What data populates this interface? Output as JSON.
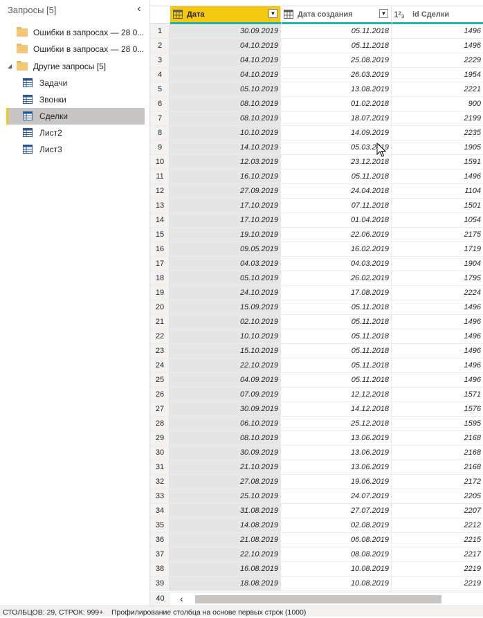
{
  "queries_pane": {
    "title": "Запросы [5]",
    "items": [
      {
        "kind": "folder",
        "label": "Ошибки в запросах — 28 0..."
      },
      {
        "kind": "folder",
        "label": "Ошибки в запросах — 28 0..."
      },
      {
        "kind": "group",
        "label": "Другие запросы [5]",
        "expanded": true
      },
      {
        "kind": "table",
        "label": "Задачи"
      },
      {
        "kind": "table",
        "label": "Звонки"
      },
      {
        "kind": "table",
        "label": "Сделки",
        "selected": true
      },
      {
        "kind": "table",
        "label": "Лист2"
      },
      {
        "kind": "table",
        "label": "Лист3"
      }
    ]
  },
  "grid": {
    "columns": [
      {
        "name": "Дата",
        "type_icon": "date-type-icon",
        "active": true
      },
      {
        "name": "Дата создания",
        "type_icon": "date-type-icon"
      },
      {
        "name": "id Сделки",
        "type_icon": "whole-number-type-icon",
        "type_glyph": "1²₃"
      }
    ],
    "rows": [
      [
        "1",
        "30.09.2019",
        "05.11.2018",
        "1496"
      ],
      [
        "2",
        "04.10.2019",
        "05.11.2018",
        "1496"
      ],
      [
        "3",
        "04.10.2019",
        "25.08.2019",
        "2229"
      ],
      [
        "4",
        "04.10.2019",
        "26.03.2019",
        "1954"
      ],
      [
        "5",
        "05.10.2019",
        "13.08.2019",
        "2221"
      ],
      [
        "6",
        "08.10.2019",
        "01.02.2018",
        "900"
      ],
      [
        "7",
        "08.10.2019",
        "18.07.2019",
        "2199"
      ],
      [
        "8",
        "10.10.2019",
        "14.09.2019",
        "2235"
      ],
      [
        "9",
        "14.10.2019",
        "05.03.2019",
        "1905"
      ],
      [
        "10",
        "12.03.2019",
        "23.12.2018",
        "1591"
      ],
      [
        "11",
        "16.10.2019",
        "05.11.2018",
        "1496"
      ],
      [
        "12",
        "27.09.2019",
        "24.04.2018",
        "1104"
      ],
      [
        "13",
        "17.10.2019",
        "07.11.2018",
        "1501"
      ],
      [
        "14",
        "17.10.2019",
        "01.04.2018",
        "1054"
      ],
      [
        "15",
        "19.10.2019",
        "22.06.2019",
        "2175"
      ],
      [
        "16",
        "09.05.2019",
        "16.02.2019",
        "1719"
      ],
      [
        "17",
        "04.03.2019",
        "04.03.2019",
        "1904"
      ],
      [
        "18",
        "05.10.2019",
        "26.02.2019",
        "1795"
      ],
      [
        "19",
        "24.10.2019",
        "17.08.2019",
        "2224"
      ],
      [
        "20",
        "15.09.2019",
        "05.11.2018",
        "1496"
      ],
      [
        "21",
        "02.10.2019",
        "05.11.2018",
        "1496"
      ],
      [
        "22",
        "10.10.2019",
        "05.11.2018",
        "1496"
      ],
      [
        "23",
        "15.10.2019",
        "05.11.2018",
        "1496"
      ],
      [
        "24",
        "22.10.2019",
        "05.11.2018",
        "1496"
      ],
      [
        "25",
        "04.09.2019",
        "05.11.2018",
        "1496"
      ],
      [
        "26",
        "07.09.2019",
        "12.12.2018",
        "1571"
      ],
      [
        "27",
        "30.09.2019",
        "14.12.2018",
        "1576"
      ],
      [
        "28",
        "06.10.2019",
        "25.12.2018",
        "1595"
      ],
      [
        "29",
        "08.10.2019",
        "13.06.2019",
        "2168"
      ],
      [
        "30",
        "30.09.2019",
        "13.06.2019",
        "2168"
      ],
      [
        "31",
        "21.10.2019",
        "13.06.2019",
        "2168"
      ],
      [
        "32",
        "27.08.2019",
        "19.06.2019",
        "2172"
      ],
      [
        "33",
        "25.10.2019",
        "24.07.2019",
        "2205"
      ],
      [
        "34",
        "31.08.2019",
        "27.07.2019",
        "2207"
      ],
      [
        "35",
        "14.08.2019",
        "02.08.2019",
        "2212"
      ],
      [
        "36",
        "21.08.2019",
        "06.08.2019",
        "2215"
      ],
      [
        "37",
        "22.10.2019",
        "08.08.2019",
        "2217"
      ],
      [
        "38",
        "16.08.2019",
        "10.08.2019",
        "2219"
      ],
      [
        "39",
        "18.08.2019",
        "10.08.2019",
        "2219"
      ]
    ],
    "last_row_number": "40"
  },
  "status_bar": {
    "columns_rows": "СТОЛБЦОВ: 29, СТРОК: 999+",
    "profiling": "Профилирование столбца на основе первых строк (1000)"
  },
  "colors": {
    "accent_yellow": "#f2c811",
    "quality_teal": "#23b2a6",
    "selected_bg": "#c8c6c4"
  }
}
